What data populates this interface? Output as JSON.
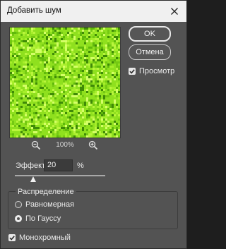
{
  "window": {
    "title": "Добавить шум",
    "close_icon": "close-icon"
  },
  "preview": {
    "noise_color": "#8fe01e",
    "zoom_out_icon": "zoom-out-icon",
    "zoom_in_icon": "zoom-in-icon",
    "zoom_level": "100%"
  },
  "buttons": {
    "ok_label": "OK",
    "cancel_label": "Отмена"
  },
  "preview_toggle": {
    "label": "Просмотр",
    "checked": true
  },
  "effect": {
    "label": "Эффект:",
    "value": "20",
    "unit": "%",
    "slider_fraction": 0.2
  },
  "distribution": {
    "legend": "Распределение",
    "options": [
      {
        "label": "Равномерная",
        "selected": false
      },
      {
        "label": "По Гауссу",
        "selected": true
      }
    ]
  },
  "monochrome": {
    "label": "Монохромный",
    "checked": true
  }
}
